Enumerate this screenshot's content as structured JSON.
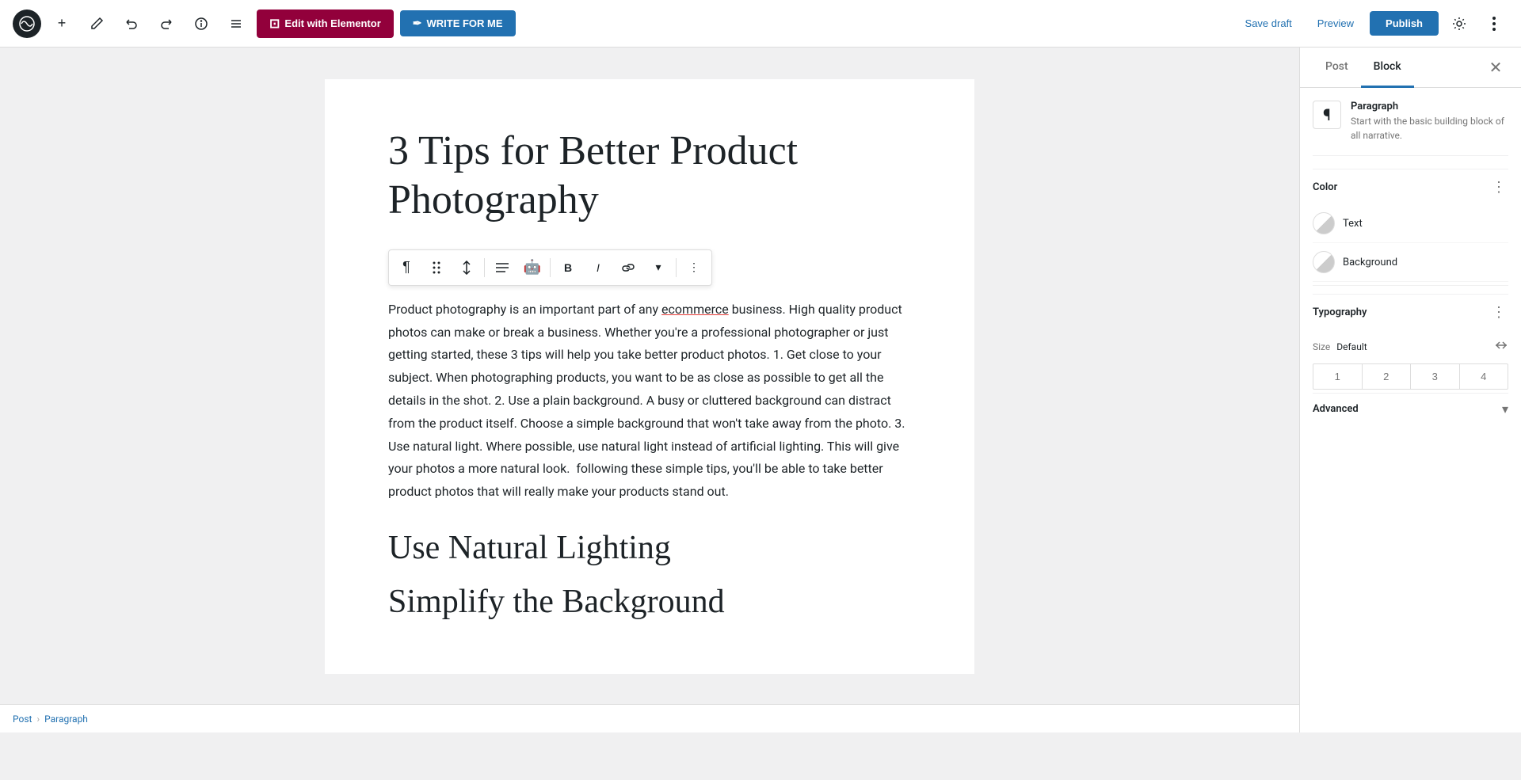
{
  "topbar": {
    "wp_logo": "W",
    "add_label": "+",
    "edit_label": "✏",
    "undo_label": "↩",
    "redo_label": "↪",
    "info_label": "ℹ",
    "list_label": "☰",
    "elementor_btn": "Edit with Elementor",
    "write_for_me_btn": "WRITE FOR ME",
    "save_draft_label": "Save draft",
    "preview_label": "Preview",
    "publish_label": "Publish",
    "settings_label": "⚙",
    "more_label": "⋮"
  },
  "editor": {
    "post_title": "3 Tips for Better Product Photography",
    "paragraph_text": "Product photography is an important part of any ecommerce business. High quality product photos can make or break a business. Whether you're a professional photographer or just getting started, these 3 tips will help you take better product photos. 1. Get close to your subject. When photographing products, you want to be as close as possible to get all the details in the shot. 2. Use a plain background. A busy or cluttered background can distract from the product itself. Choose a simple background that won't take away from the photo. 3. Use natural light. Where possible, use natural light instead of artificial lighting. This will give your photos a more natural look.  following these simple tips, you'll be able to take better product photos that will really make your products stand out.",
    "underline_word": "ecommerce",
    "section_heading": "Use Natural Lighting",
    "partial_heading": "Simplify the Background"
  },
  "block_toolbar": {
    "paragraph_icon": "¶",
    "drag_icon": "⠿",
    "arrows_icon": "⇅",
    "align_icon": "≡",
    "robot_icon": "🤖",
    "bold_label": "B",
    "italic_label": "I",
    "link_icon": "🔗",
    "more_icon": "⋮"
  },
  "sidebar": {
    "post_tab": "Post",
    "block_tab": "Block",
    "close_icon": "✕",
    "block_name": "Paragraph",
    "block_desc": "Start with the basic building block of all narrative.",
    "color_section_title": "Color",
    "color_menu_icon": "⋮",
    "text_color_label": "Text",
    "background_color_label": "Background",
    "typography_section_title": "Typography",
    "typography_menu_icon": "⋮",
    "typography_reset_icon": "⇄",
    "size_label": "Size",
    "size_default": "Default",
    "size_options": [
      "1",
      "2",
      "3",
      "4"
    ],
    "advanced_section_title": "Advanced",
    "advanced_chevron": "▾"
  },
  "breadcrumb": {
    "post_label": "Post",
    "separator": "›",
    "paragraph_label": "Paragraph"
  },
  "colors": {
    "accent": "#2271b1",
    "active_tab_border": "#2271b1",
    "publish_bg": "#2271b1"
  }
}
